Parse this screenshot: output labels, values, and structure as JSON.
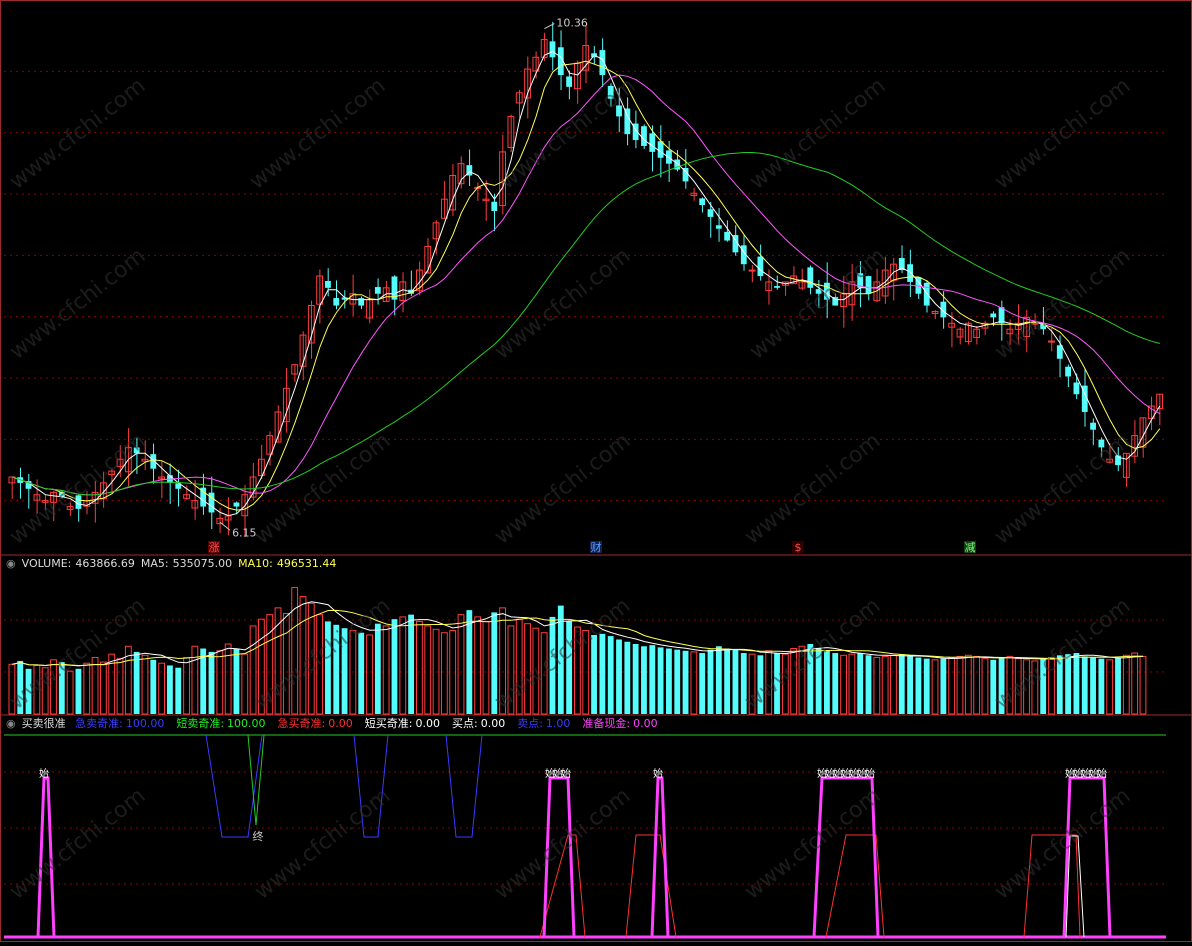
{
  "colors": {
    "up": "#ff3c3c",
    "down": "#54fcfc",
    "ma_white": "#ffffff",
    "ma_yellow": "#ffff55",
    "ma_magenta": "#ff55ff",
    "ma_green": "#22cc22",
    "grid": "#8b0000",
    "separator": "#9c2b2b"
  },
  "price_panel": {
    "high_label": "10.36",
    "low_label": "6.15",
    "markers": [
      {
        "text": "涨",
        "color": "#ff5050",
        "bg": "#600000"
      },
      {
        "text": "财",
        "color": "#5aa0ff",
        "bg": "#102050"
      },
      {
        "text": "$",
        "color": "#ff5050",
        "bg": "#300000"
      },
      {
        "text": "减",
        "color": "#80ff80",
        "bg": "#104010"
      }
    ]
  },
  "volume_panel": {
    "title": "VOLUME:",
    "value": "463866.69",
    "ma5_label": "MA5:",
    "ma5_value": "535075.00",
    "ma10_label": "MA10:",
    "ma10_value": "496531.44"
  },
  "indicator_panel": {
    "name": "买卖很准",
    "items": [
      {
        "label": "急卖奇准:",
        "value": "100.00",
        "color": "#3a3aff"
      },
      {
        "label": "短卖奇准:",
        "value": "100.00",
        "color": "#22ee22"
      },
      {
        "label": "急买奇准:",
        "value": "0.00",
        "color": "#ff3030"
      },
      {
        "label": "短买奇准:",
        "value": "0.00",
        "color": "#ffffff"
      },
      {
        "label": "买点:",
        "value": "0.00",
        "color": "#ffffff"
      },
      {
        "label": "卖点:",
        "value": "1.00",
        "color": "#3a3aff"
      },
      {
        "label": "准备现金:",
        "value": "0.00",
        "color": "#ff40ff"
      }
    ],
    "signal_label_start": "始",
    "signal_label_end": "终"
  },
  "watermark": "www.cfchi.com",
  "chart_data": [
    {
      "type": "candlestick",
      "description_series": [
        "MA white",
        "MA yellow",
        "MA magenta",
        "MA green"
      ],
      "high": 10.36,
      "low": 6.15,
      "closes": [
        6.55,
        6.5,
        6.45,
        6.4,
        6.35,
        6.42,
        6.38,
        6.3,
        6.28,
        6.35,
        6.42,
        6.5,
        6.6,
        6.7,
        6.8,
        6.75,
        6.7,
        6.62,
        6.55,
        6.5,
        6.45,
        6.4,
        6.35,
        6.3,
        6.25,
        6.2,
        6.22,
        6.3,
        6.4,
        6.55,
        6.7,
        6.9,
        7.1,
        7.3,
        7.5,
        7.75,
        8.0,
        8.25,
        8.15,
        8.0,
        8.05,
        8.1,
        8.0,
        8.05,
        8.1,
        8.15,
        8.05,
        8.2,
        8.1,
        8.3,
        8.5,
        8.7,
        8.9,
        9.1,
        9.2,
        9.1,
        9.0,
        8.9,
        8.8,
        9.3,
        9.6,
        9.8,
        10.0,
        10.1,
        10.25,
        10.1,
        9.95,
        9.85,
        10.05,
        10.2,
        10.1,
        9.95,
        9.75,
        9.6,
        9.45,
        9.4,
        9.35,
        9.3,
        9.25,
        9.2,
        9.15,
        9.05,
        8.95,
        8.85,
        8.75,
        8.65,
        8.55,
        8.45,
        8.35,
        8.3,
        8.25,
        8.2,
        8.15,
        8.2,
        8.25,
        8.2,
        8.15,
        8.1,
        8.05,
        8.0,
        8.1,
        8.2,
        8.15,
        8.1,
        8.2,
        8.3,
        8.35,
        8.3,
        8.2,
        8.1,
        8.0,
        7.95,
        7.9,
        7.85,
        7.8,
        7.85,
        7.8,
        7.85,
        7.9,
        7.85,
        7.8,
        7.85,
        7.9,
        7.85,
        7.8,
        7.7,
        7.55,
        7.4,
        7.25,
        7.1,
        6.95,
        6.8,
        6.7,
        6.65,
        6.75,
        6.9,
        7.05,
        7.15,
        7.25
      ]
    },
    {
      "type": "bar",
      "title": "VOLUME",
      "values": [
        220,
        235,
        200,
        215,
        205,
        240,
        230,
        190,
        200,
        225,
        250,
        230,
        265,
        245,
        300,
        275,
        260,
        240,
        225,
        215,
        205,
        250,
        300,
        290,
        275,
        280,
        310,
        290,
        265,
        390,
        420,
        440,
        470,
        445,
        560,
        520,
        490,
        440,
        410,
        395,
        380,
        370,
        360,
        350,
        400,
        390,
        420,
        430,
        440,
        410,
        390,
        375,
        360,
        370,
        440,
        460,
        430,
        410,
        450,
        470,
        390,
        420,
        400,
        380,
        360,
        430,
        480,
        410,
        385,
        370,
        350,
        355,
        345,
        330,
        320,
        310,
        300,
        305,
        295,
        290,
        285,
        280,
        275,
        270,
        285,
        300,
        290,
        285,
        270,
        265,
        260,
        280,
        270,
        265,
        290,
        300,
        310,
        290,
        280,
        270,
        260,
        265,
        270,
        260,
        250,
        255,
        260,
        265,
        255,
        250,
        245,
        240,
        245,
        250,
        255,
        260,
        255,
        245,
        240,
        250,
        255,
        245,
        240,
        235,
        245,
        250,
        260,
        265,
        270,
        255,
        250,
        245,
        240,
        250,
        260,
        270,
        255
      ],
      "ma5": 535075.0,
      "ma10": 496531.44
    },
    {
      "type": "line",
      "title": "买卖很准",
      "series": [
        {
          "name": "急卖奇准",
          "values": [
            100,
            0,
            100
          ]
        },
        {
          "name": "短卖奇准",
          "values": [
            100,
            0,
            100
          ]
        },
        {
          "name": "急买奇准",
          "values": [
            0,
            0,
            0
          ]
        },
        {
          "name": "短买奇准",
          "values": [
            0,
            0,
            0
          ]
        },
        {
          "name": "买点",
          "values": [
            0,
            0,
            0
          ]
        },
        {
          "name": "卖点",
          "values": [
            1,
            1,
            1
          ]
        },
        {
          "name": "准备现金",
          "values": [
            0,
            100,
            0
          ]
        }
      ]
    }
  ]
}
